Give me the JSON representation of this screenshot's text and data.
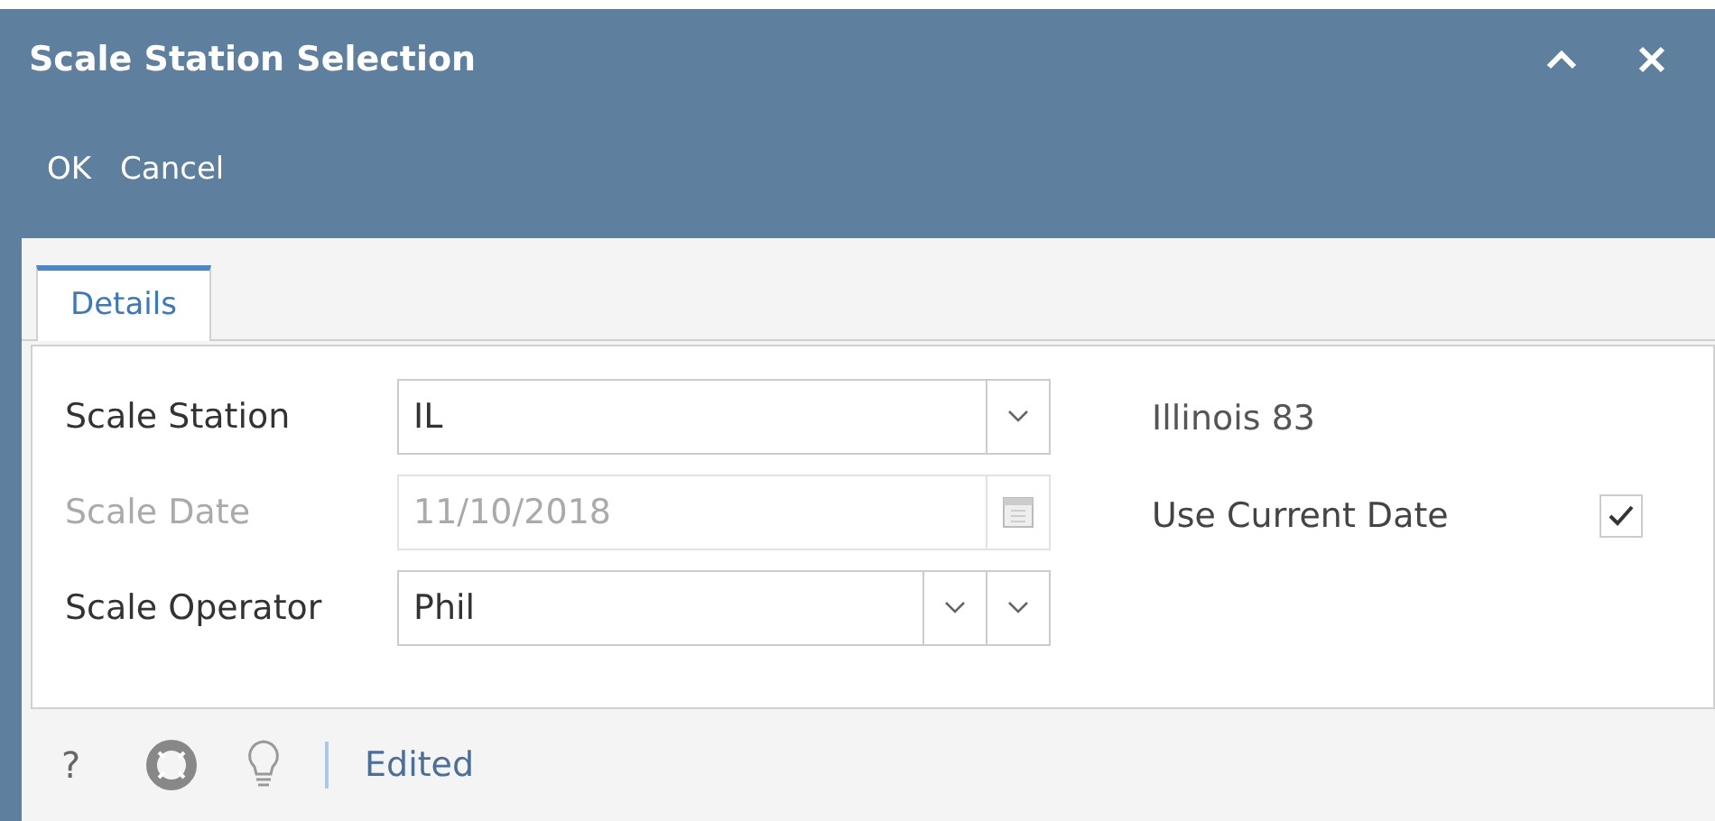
{
  "window": {
    "title": "Scale Station Selection"
  },
  "toolbar": [
    "OK",
    "Cancel"
  ],
  "tabs": [
    {
      "label": "Details",
      "selected": true
    }
  ],
  "fields": [
    {
      "label": "Scale Station",
      "value": "IL",
      "kind": "combo",
      "disabled": false
    },
    {
      "label": "Scale Date",
      "value": "11/10/2018",
      "kind": "date",
      "disabled": true
    },
    {
      "label": "Scale Operator",
      "value": "Phil",
      "kind": "combo2",
      "disabled": false
    }
  ],
  "station_name": "Illinois 83",
  "use_current_date": {
    "label": "Use Current Date",
    "checked": true
  },
  "status_bar": {
    "help": "?",
    "status": "Edited"
  }
}
